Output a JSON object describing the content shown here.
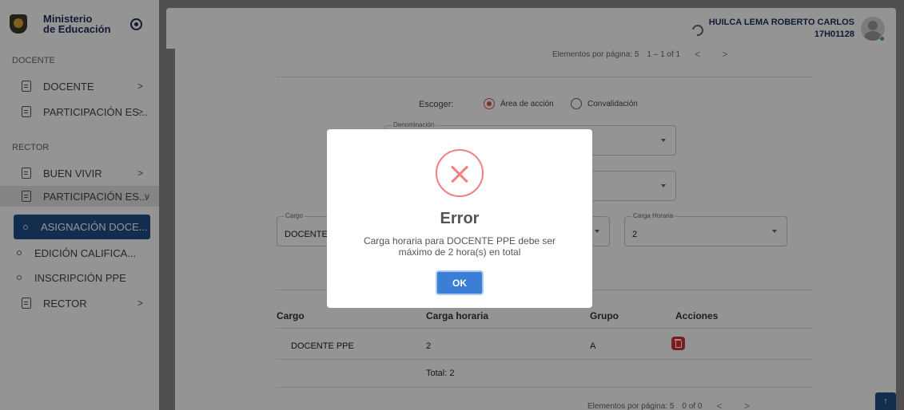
{
  "brand": {
    "line1": "Ministerio",
    "line2": "de Educación"
  },
  "sidebar": {
    "section_docente": "DOCENTE",
    "section_rector": "RECTOR",
    "items": [
      {
        "label": "DOCENTE",
        "chevron": ">"
      },
      {
        "label": "PARTICIPACIÓN ES...",
        "chevron": ">"
      },
      {
        "label": "BUEN VIVIR",
        "chevron": ">"
      },
      {
        "label": "PARTICIPACIÓN ES...",
        "chevron": "v"
      },
      {
        "label": "RECTOR",
        "chevron": ">"
      }
    ],
    "sub_items": [
      {
        "label": "ASIGNACIÓN DOCE..."
      },
      {
        "label": "EDICIÓN CALIFICA..."
      },
      {
        "label": "INSCRIPCIÓN PPE"
      }
    ]
  },
  "topbar": {
    "user_name": "HUILCA LEMA ROBERTO CARLOS",
    "user_code": "17H01128"
  },
  "main": {
    "pager_top": {
      "label": "Elementos por página: 5",
      "range": "1 – 1 of 1",
      "nav": "< >"
    },
    "choose_label": "Escoger:",
    "radio_area": "Área de acción",
    "radio_conv": "Convalidación",
    "field_denominacion": {
      "label": "Denominación",
      "value": ""
    },
    "field_cargo": {
      "label": "Cargo",
      "value": "DOCENTE PPE"
    },
    "field_carga": {
      "label": "Carga Horaria",
      "value": "2"
    },
    "table": {
      "headers": [
        "Cargo",
        "Carga horaria",
        "Grupo",
        "Acciones"
      ],
      "rows": [
        {
          "cargo": "DOCENTE PPE",
          "carga": "2",
          "grupo": "A"
        }
      ],
      "total": "Total: 2"
    },
    "pager_bottom": {
      "label": "Elementos por página: 5",
      "range": "0 of 0",
      "nav": "< >"
    },
    "scroll_top": "↑"
  },
  "modal": {
    "title": "Error",
    "message": "Carga horaria para DOCENTE PPE debe ser máximo de 2 hora(s) en total",
    "ok_label": "OK"
  },
  "colors": {
    "primary": "#1f4e86",
    "error": "#f08080",
    "ok_button": "#3a7fd5",
    "delete": "#d93030"
  }
}
